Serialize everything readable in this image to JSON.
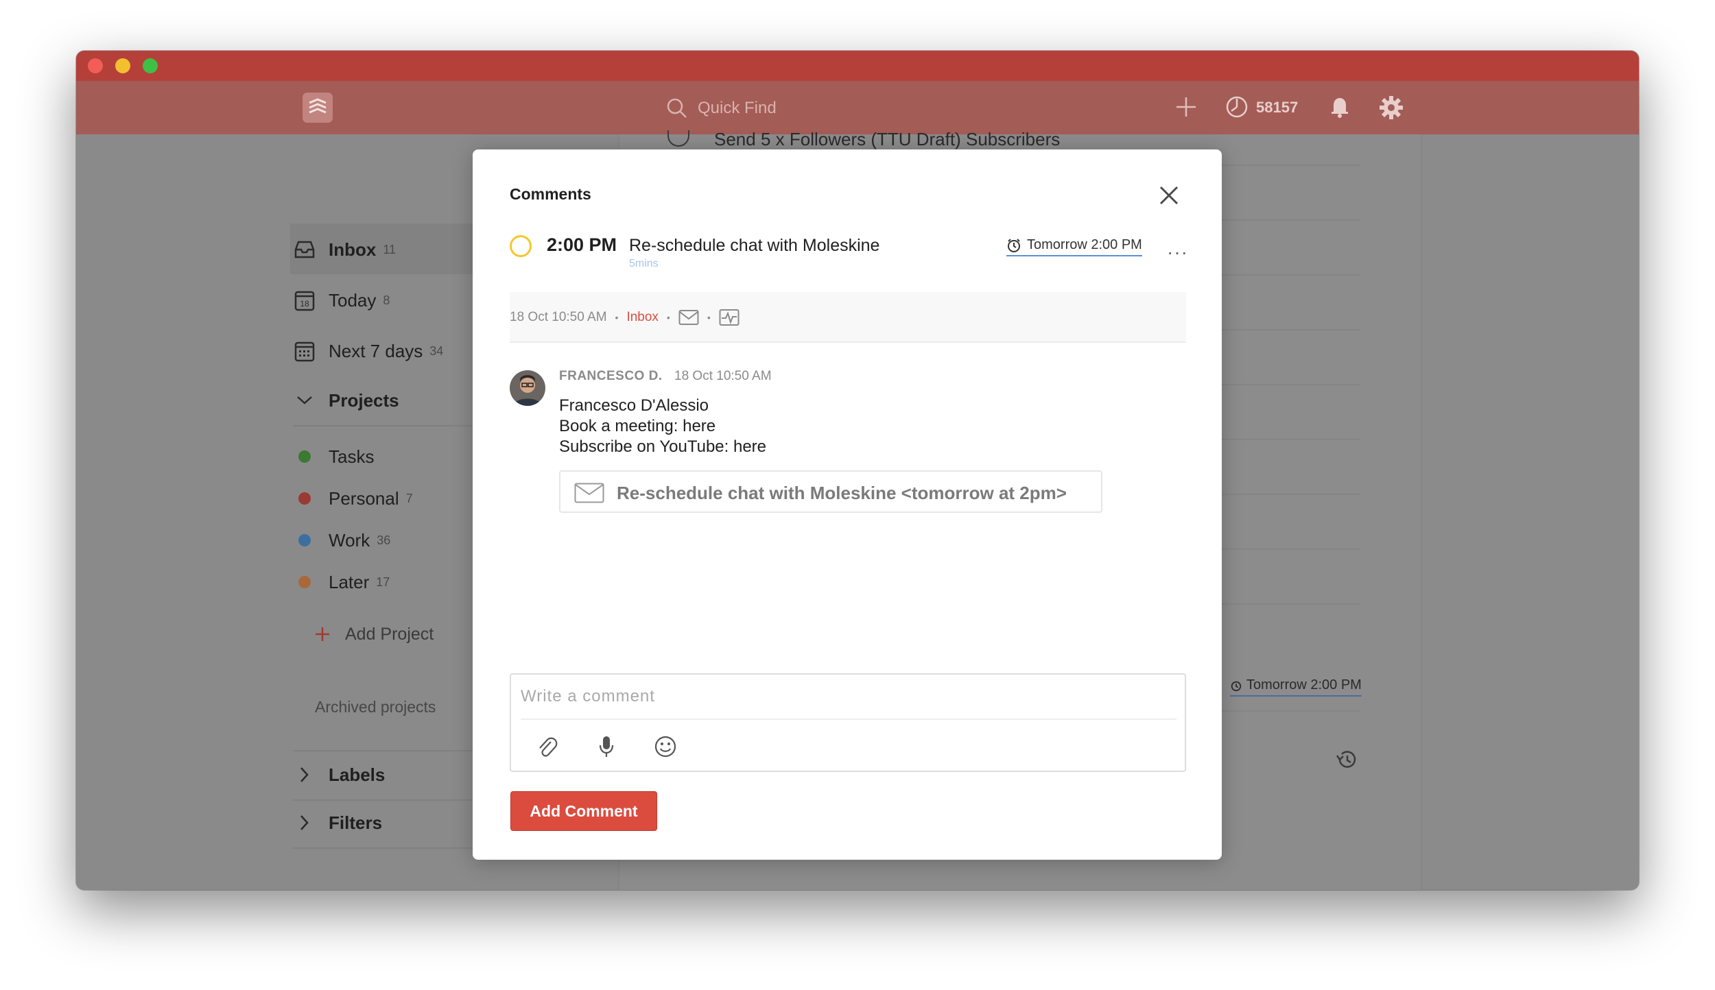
{
  "topbar": {
    "search_placeholder": "Quick Find",
    "karma": "58157"
  },
  "sidebar": {
    "items": [
      {
        "label": "Inbox",
        "count": "11"
      },
      {
        "label": "Today",
        "count": "8"
      },
      {
        "label": "Next 7 days",
        "count": "34"
      }
    ],
    "today_date_icon": "18",
    "projects_heading": "Projects",
    "projects": [
      {
        "label": "Tasks",
        "count": "",
        "color": "#3a7a32"
      },
      {
        "label": "Personal",
        "count": "7",
        "color": "#9a3a32"
      },
      {
        "label": "Work",
        "count": "36",
        "color": "#3c6fa0"
      },
      {
        "label": "Later",
        "count": "17",
        "color": "#a9683a"
      }
    ],
    "add_project": "Add Project",
    "archived": "Archived projects",
    "labels": "Labels",
    "filters": "Filters"
  },
  "background": {
    "top_task": "Send 5 x Followers (TTU Draft) Subscribers",
    "due": "Tomorrow 2:00 PM"
  },
  "modal": {
    "title": "Comments",
    "task": {
      "time": "2:00 PM",
      "title": "Re-schedule chat with Moleskine",
      "duration": "5mins",
      "due": "Tomorrow 2:00 PM",
      "more": "···"
    },
    "meta": {
      "created": "18 Oct 10:50 AM",
      "project": "Inbox"
    },
    "comment": {
      "author": "FRANCESCO D.",
      "time": "18 Oct 10:50 AM",
      "lines": [
        "Francesco D'Alessio",
        "Book a meeting: here",
        "Subscribe on YouTube: here"
      ],
      "attachment": "Re-schedule chat with Moleskine <tomorrow at 2pm>"
    },
    "editor": {
      "placeholder": "Write a comment"
    },
    "add_button": "Add Comment"
  },
  "colors": {
    "brand": "#db4c3f",
    "titlebar": "#b5403a",
    "priority_ring": "#f3c82b",
    "due_underline": "#5b8fd4"
  }
}
